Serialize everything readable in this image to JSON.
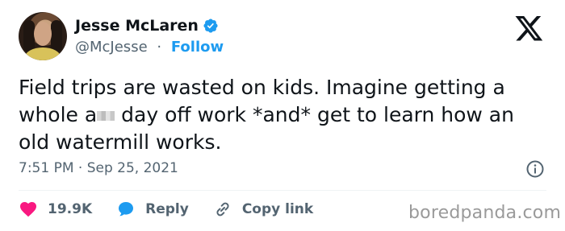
{
  "author": {
    "display_name": "Jesse McLaren",
    "handle": "@McJesse",
    "separator": "·",
    "follow_label": "Follow",
    "verified": true
  },
  "tweet": {
    "text_part1": "Field trips are wasted on kids. Imagine getting a whole a",
    "text_part2": " day off work *and* get to learn how an old watermill works.",
    "timestamp": "7:51 PM · Sep 25, 2021"
  },
  "actions": {
    "likes_count": "19.9K",
    "reply_label": "Reply",
    "copy_link_label": "Copy link"
  },
  "watermark": "boredpanda.com",
  "colors": {
    "accent": "#1d9bf0",
    "like": "#f91880",
    "text": "#0f1419",
    "secondary": "#536471"
  },
  "icons": [
    "verified-badge-icon",
    "x-logo-icon",
    "info-icon",
    "heart-icon",
    "reply-bubble-icon",
    "link-icon"
  ]
}
